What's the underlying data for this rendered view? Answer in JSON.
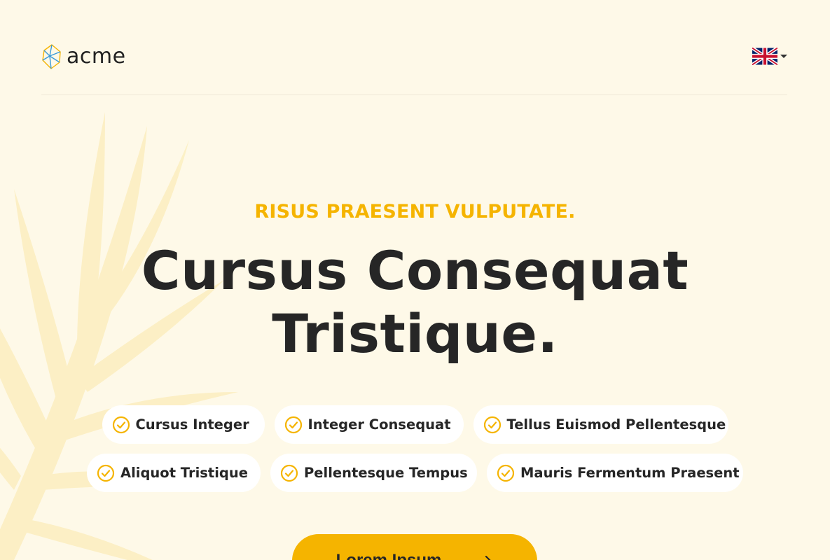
{
  "brand": {
    "name": "acme"
  },
  "language": {
    "icon": "uk-flag-icon",
    "dropdown_icon": "caret-down-icon"
  },
  "hero": {
    "eyebrow": "RISUS PRAESENT VULPUTATE.",
    "headline_line1": "Cursus Consequat",
    "headline_line2": "Tristique."
  },
  "features": {
    "row1": [
      "Cursus Integer",
      "Integer Consequat",
      "Tellus Euismod Pellentesque"
    ],
    "row2": [
      "Aliquot Tristique",
      "Pellentesque Tempus",
      "Mauris Fermentum Praesent"
    ]
  },
  "cta": {
    "label": "Lorem Ipsum"
  },
  "colors": {
    "accent": "#f5b400",
    "background": "#fef9e8",
    "text": "#262626",
    "chip": "#ffffff"
  }
}
